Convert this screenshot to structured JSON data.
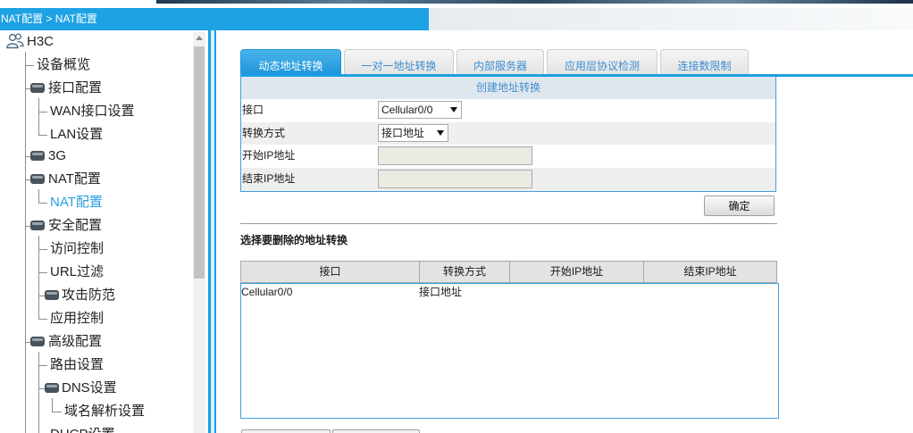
{
  "page": {
    "breadcrumb": "NAT配置 > NAT配置"
  },
  "sidebar": {
    "root": {
      "label": "H3C",
      "icon": "users-icon"
    },
    "items": [
      {
        "label": "设备概览"
      },
      {
        "label": "接口配置",
        "icon": "folder-icon"
      },
      {
        "label": "WAN接口设置"
      },
      {
        "label": "LAN设置"
      },
      {
        "label": "3G",
        "icon": "folder-icon"
      },
      {
        "label": "NAT配置",
        "icon": "folder-icon"
      },
      {
        "label": "NAT配置",
        "selected": true
      },
      {
        "label": "安全配置",
        "icon": "folder-icon"
      },
      {
        "label": "访问控制"
      },
      {
        "label": "URL过滤"
      },
      {
        "label": "攻击防范",
        "icon": "folder-icon"
      },
      {
        "label": "应用控制"
      },
      {
        "label": "高级配置",
        "icon": "folder-icon"
      },
      {
        "label": "路由设置"
      },
      {
        "label": "DNS设置",
        "icon": "folder-icon"
      },
      {
        "label": "域名解析设置"
      },
      {
        "label": "DHCP设置"
      }
    ]
  },
  "tabs": [
    {
      "label": "动态地址转换",
      "active": true
    },
    {
      "label": "一对一地址转换"
    },
    {
      "label": "内部服务器"
    },
    {
      "label": "应用层协议检测"
    },
    {
      "label": "连接数限制"
    }
  ],
  "form": {
    "title": "创建地址转换",
    "interface": {
      "label": "接口",
      "value": "Cellular0/0"
    },
    "mode": {
      "label": "转换方式",
      "value": "接口地址"
    },
    "start_ip": {
      "label": "开始IP地址",
      "value": ""
    },
    "end_ip": {
      "label": "结束IP地址",
      "value": ""
    },
    "confirm_label": "确定"
  },
  "delete_list": {
    "title": "选择要删除的地址转换",
    "columns": [
      "接口",
      "转换方式",
      "开始IP地址",
      "结束IP地址"
    ],
    "rows": [
      [
        "Cellular0/0",
        "接口地址",
        "",
        ""
      ]
    ]
  },
  "colors": {
    "accent": "#1da2e3",
    "selected_text": "#2a9ee0",
    "panel_border": "#3fa0dc",
    "tab_inactive_text": "#3d8ed2"
  }
}
